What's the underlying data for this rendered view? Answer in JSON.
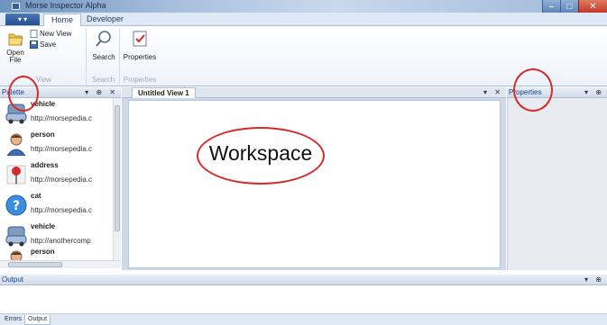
{
  "window": {
    "title": "Morse Inspector Alpha"
  },
  "ribbon": {
    "tabs": [
      "Home",
      "Developer"
    ],
    "groups": {
      "file": {
        "open_label": "Open File",
        "new_view_label": "New View",
        "save_label": "Save",
        "group_label": "View"
      },
      "search": {
        "search_label": "Search",
        "group_label": "Search"
      },
      "properties": {
        "properties_label": "Properties",
        "group_label": "Properties"
      }
    }
  },
  "palette": {
    "title": "Palette",
    "items": [
      {
        "name": "vehicle",
        "url": "http://morsepedia.c",
        "icon": "vehicle-icon"
      },
      {
        "name": "person",
        "url": "http://morsepedia.c",
        "icon": "person-icon"
      },
      {
        "name": "address",
        "url": "http://morsepedia.c",
        "icon": "pin-icon"
      },
      {
        "name": "cat",
        "url": "http://morsepedia.c",
        "icon": "question-icon"
      },
      {
        "name": "vehicle",
        "url": "http://anothercomp",
        "icon": "vehicle-icon"
      },
      {
        "name": "person",
        "url": "",
        "icon": "person-icon"
      }
    ]
  },
  "document": {
    "tab_label": "Untitled View 1",
    "workspace_annotation": "Workspace"
  },
  "properties_panel": {
    "title": "Properties"
  },
  "output_panel": {
    "title": "Output"
  },
  "bottom_tabs": [
    "Errors",
    "Output"
  ],
  "colors": {
    "accent": "#15428b",
    "annotation": "#d52b2b",
    "ribbon_bg": "#dfe9f5"
  }
}
